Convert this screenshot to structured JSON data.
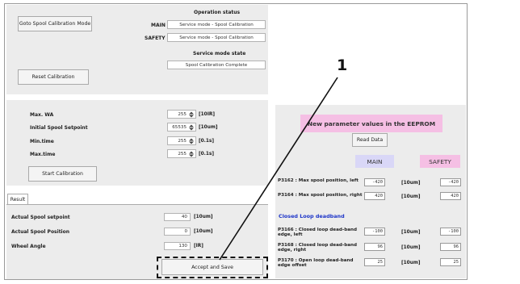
{
  "top": {
    "goto_button": "Goto Spool Calibration Mode",
    "reset_button": "Reset Calibration",
    "operation_status": {
      "title": "Operation status",
      "main_label": "MAIN",
      "main_value": "Service mode - Spool Calibration",
      "safety_label": "SAFETY",
      "safety_value": "Service mode - Spool Calibration"
    },
    "service_mode": {
      "title": "Service mode state",
      "value": "Spool Calibration Complete"
    }
  },
  "params": {
    "rows": [
      {
        "label": "Max. WA",
        "value": "255",
        "unit": "[10IR]"
      },
      {
        "label": "Initial Spool Setpoint",
        "value": "65535",
        "unit": "[10um]"
      },
      {
        "label": "Min.time",
        "value": "255",
        "unit": "[0.1s]"
      },
      {
        "label": "Max.time",
        "value": "255",
        "unit": "[0.1s]"
      }
    ],
    "start_button": "Start Calibration"
  },
  "result": {
    "tab": "Result",
    "rows": [
      {
        "label": "Actual Spool setpoint",
        "value": "40",
        "unit": "[10um]"
      },
      {
        "label": "Actual Spool Position",
        "value": "0",
        "unit": "[10um]"
      },
      {
        "label": "Wheel Angle",
        "value": "130",
        "unit": "[IR]"
      }
    ],
    "accept_button": "Accept and Save"
  },
  "eeprom": {
    "title": "New parameter values in the EEPROM",
    "read_button": "Read Data",
    "main_header": "MAIN",
    "safety_header": "SAFETY",
    "rows": [
      {
        "label": "P3162 : Max spool position, left",
        "main": "-420",
        "unit": "[10um]",
        "safety": "-420"
      },
      {
        "label": "P3164 : Max spool position, right",
        "main": "420",
        "unit": "[10um]",
        "safety": "420"
      }
    ],
    "deadband_title": "Closed Loop deadband",
    "deadband_rows": [
      {
        "label": "P3166 : Closed loop dead-band edge, left",
        "main": "-100",
        "unit": "[10um]",
        "safety": "-100"
      },
      {
        "label": "P3168 : Closed loop dead-band edge, right",
        "main": "96",
        "unit": "[10um]",
        "safety": "96"
      },
      {
        "label": "P3170 : Open loop dead-band edge offset",
        "main": "25",
        "unit": "[10um]",
        "safety": "25"
      }
    ]
  },
  "callout": {
    "number": "1"
  },
  "colors": {
    "panel": "#ececec",
    "eeprom_title_bg": "#f5bfe4",
    "main_header_bg": "#d9d7f7",
    "safety_header_bg": "#f5bfe4",
    "deadband_text": "#1c34c8"
  }
}
